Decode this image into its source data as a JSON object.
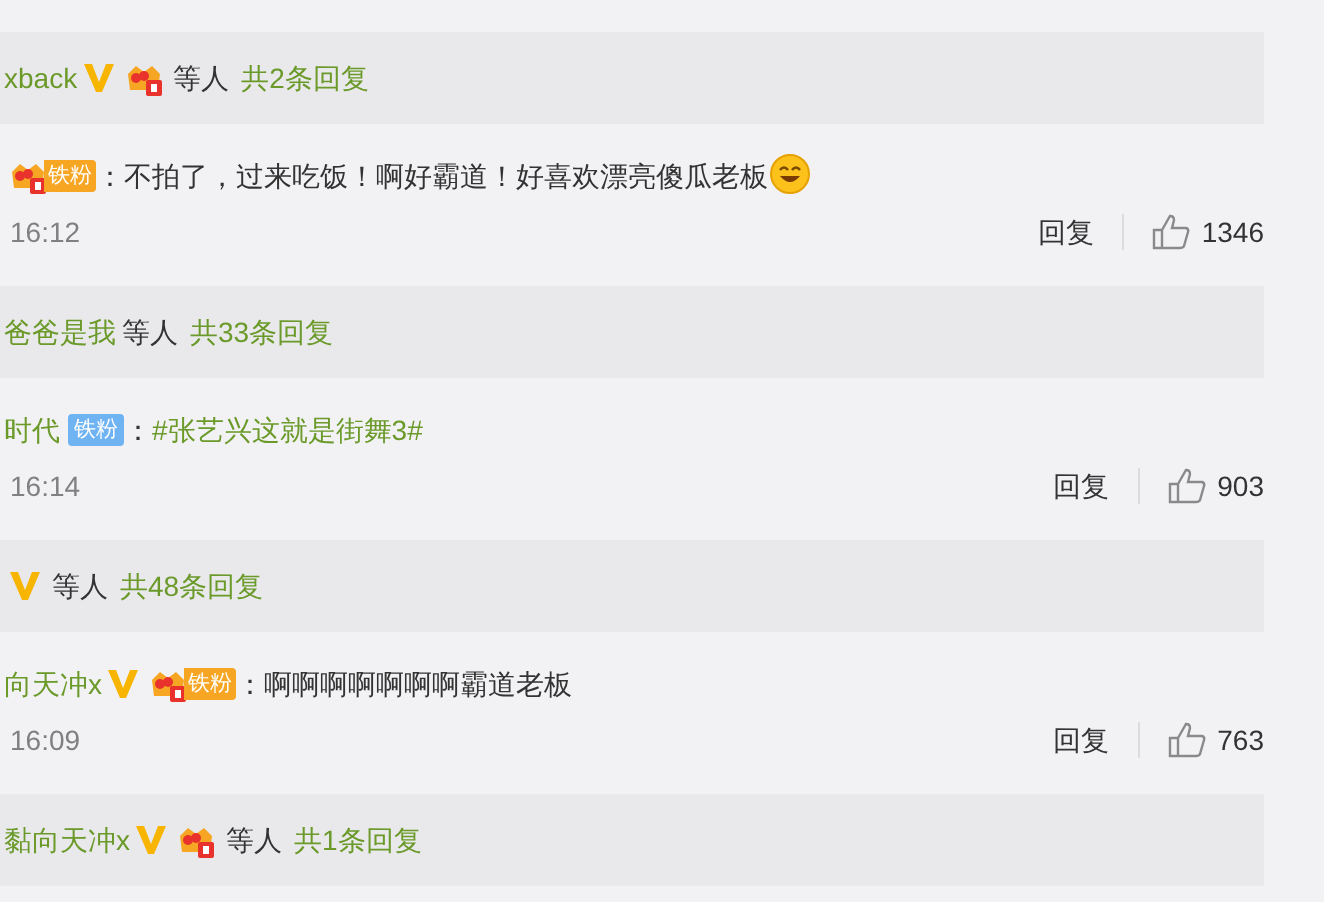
{
  "items": [
    {
      "kind": "replies",
      "name": "xback",
      "vip": true,
      "crown": true,
      "others": "等人",
      "link": "共2条回复"
    },
    {
      "kind": "comment",
      "vip": false,
      "fan_badge": {
        "kind": "crown",
        "label": "铁粉"
      },
      "colon": "：",
      "text": "不拍了，过来吃饭！啊好霸道！好喜欢漂亮傻瓜老板",
      "emoji": true,
      "time": "16:12",
      "reply": "回复",
      "likes": "1346"
    },
    {
      "kind": "replies",
      "name": "爸爸是我",
      "vip": false,
      "crown": false,
      "others": "等人",
      "link": "共33条回复"
    },
    {
      "kind": "comment",
      "name": "时代",
      "vip": false,
      "fan_badge": {
        "kind": "plain",
        "label": "铁粉"
      },
      "colon": "：",
      "hashtag": "#张艺兴这就是街舞3#",
      "emoji": false,
      "time": "16:14",
      "reply": "回复",
      "likes": "903"
    },
    {
      "kind": "replies",
      "vip": true,
      "crown": false,
      "others": "等人",
      "link": "共48条回复"
    },
    {
      "kind": "comment",
      "name": "向天冲x",
      "vip": true,
      "fan_badge": {
        "kind": "crown",
        "label": "铁粉"
      },
      "colon": "：",
      "text": "啊啊啊啊啊啊啊霸道老板",
      "emoji": false,
      "time": "16:09",
      "reply": "回复",
      "likes": "763"
    },
    {
      "kind": "replies",
      "name": "黏向天冲x",
      "vip": true,
      "crown": true,
      "others": "等人",
      "link": "共1条回复"
    }
  ]
}
